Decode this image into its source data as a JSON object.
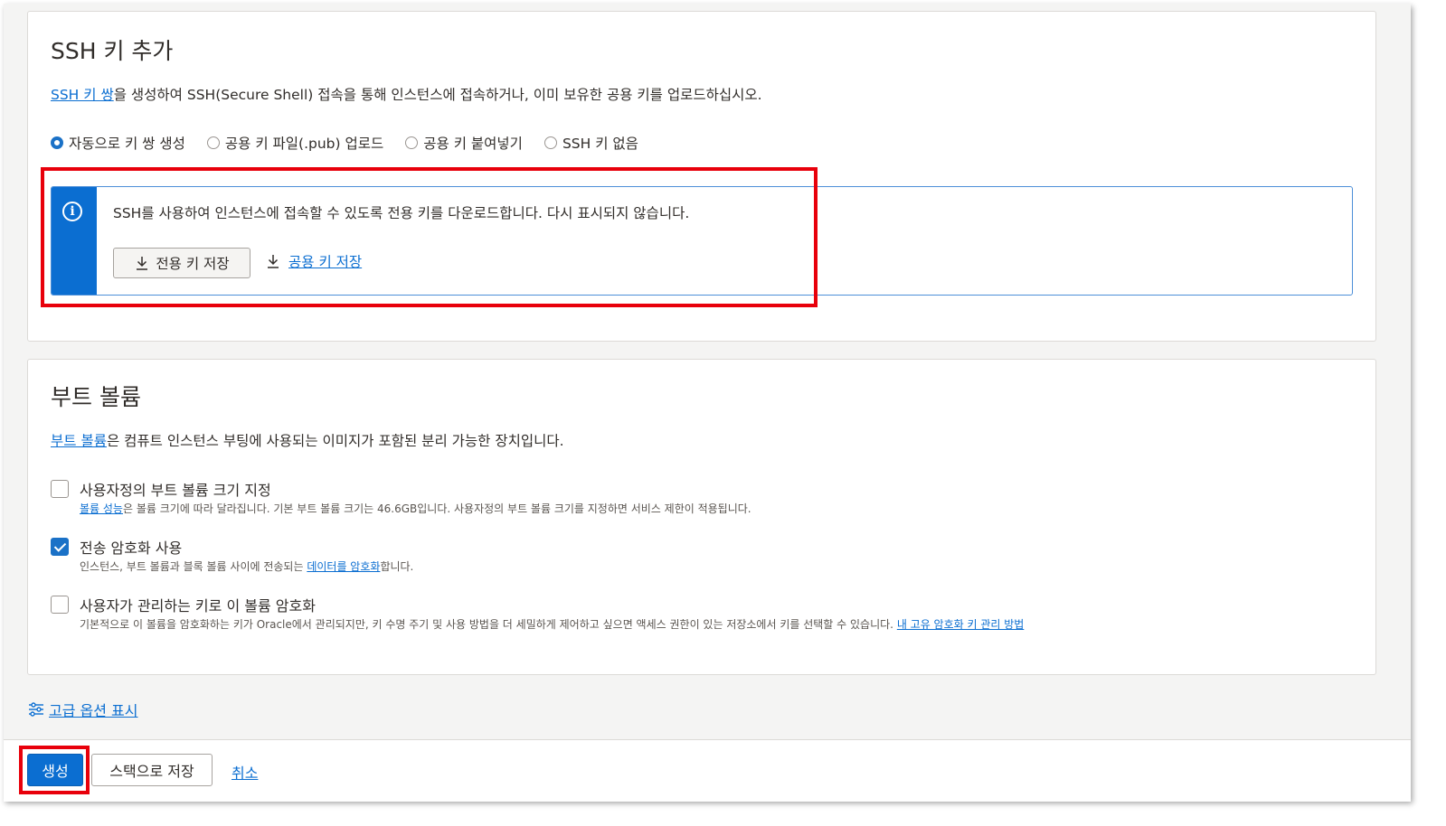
{
  "ssh_section": {
    "title": "SSH 키 추가",
    "desc_link": "SSH 키 쌍",
    "desc_rest": "을 생성하여 SSH(Secure Shell) 접속을 통해 인스턴스에 접속하거나, 이미 보유한 공용 키를 업로드하십시오.",
    "radios": [
      {
        "label": "자동으로 키 쌍 생성",
        "selected": true
      },
      {
        "label": "공용 키 파일(.pub) 업로드",
        "selected": false
      },
      {
        "label": "공용 키 붙여넣기",
        "selected": false
      },
      {
        "label": "SSH 키 없음",
        "selected": false
      }
    ],
    "info_text": "SSH를 사용하여 인스턴스에 접속할 수 있도록 전용 키를 다운로드합니다. 다시 표시되지 않습니다.",
    "save_private_label": "전용 키 저장",
    "save_public_label": "공용 키 저장"
  },
  "boot_section": {
    "title": "부트 볼륨",
    "desc_link": "부트 볼륨",
    "desc_rest": "은 컴퓨트 인스턴스 부팅에 사용되는 이미지가 포함된 분리 가능한 장치입니다.",
    "options": [
      {
        "label": "사용자정의 부트 볼륨 크기 지정",
        "checked": false,
        "help_link": "볼륨 성능",
        "help_rest": "은 볼륨 크기에 따라 달라집니다. 기본 부트 볼륨 크기는 46.6GB입니다. 사용자정의 부트 볼륨 크기를 지정하면 서비스 제한이 적용됩니다."
      },
      {
        "label": "전송 암호화 사용",
        "checked": true,
        "help_pre": "인스턴스, 부트 볼륨과 블록 볼륨 사이에 전송되는 ",
        "help_link": "데이터를 암호화",
        "help_post": "합니다."
      },
      {
        "label": "사용자가 관리하는 키로 이 볼륨 암호화",
        "checked": false,
        "help_pre": "기본적으로 이 볼륨을 암호화하는 키가 Oracle에서 관리되지만, 키 수명 주기 및 사용 방법을 더 세밀하게 제어하고 싶으면 액세스 권한이 있는 저장소에서 키를 선택할 수 있습니다. ",
        "help_link": "내 고유 암호화 키 관리 방법"
      }
    ]
  },
  "advanced_link": "고급 옵션 표시",
  "footer": {
    "create_label": "생성",
    "save_stack_label": "스택으로 저장",
    "cancel_label": "취소"
  },
  "colors": {
    "accent": "#0b6ed1",
    "highlight": "#e8000b"
  },
  "icons": [
    "info-icon",
    "download-icon",
    "settings-sliders-icon"
  ]
}
